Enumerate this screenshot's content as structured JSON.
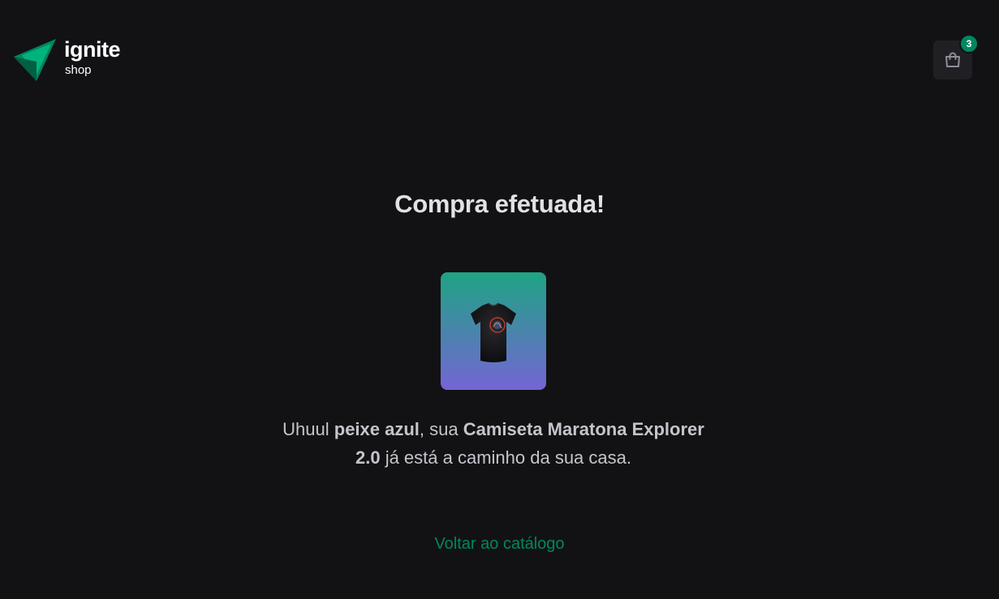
{
  "header": {
    "logo": {
      "title": "ignite",
      "subtitle": "shop"
    },
    "cart": {
      "count": "3",
      "icon": "shopping-bag-icon"
    }
  },
  "main": {
    "title": "Compra efetuada!",
    "product_image": {
      "alt": "Camiseta Maratona Explorer 2.0"
    },
    "message": {
      "prefix": "Uhuul ",
      "customer_name": "peixe azul",
      "mid": ", sua ",
      "product_name": "Camiseta Maratona Explorer 2.0",
      "suffix": " já está a caminho da sua casa."
    },
    "back_link": "Voltar ao catálogo"
  },
  "colors": {
    "background": "#121214",
    "accent": "#00875f",
    "cart_button_bg": "#202024",
    "image_gradient_top": "#1ea483",
    "image_gradient_bottom": "#7465d4"
  }
}
